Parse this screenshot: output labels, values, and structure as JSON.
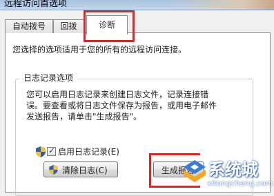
{
  "window": {
    "title": "远程访问首选项"
  },
  "tabs": [
    {
      "label": "自动拨号"
    },
    {
      "label": "回拨"
    },
    {
      "label": "诊断"
    }
  ],
  "description": "您选择的选项适用于您的所有的远程访问连接。",
  "log_group": {
    "title": "日志记录选项",
    "text_lines": [
      "您可以启用日志记录来创建日志文件，记录连接错",
      "误。要查看或将日志文件保存为报告，或用电子邮件",
      "发送报告，请单击\"生成报告\"。"
    ],
    "enable_logging": {
      "label": "启用日志记录(E)",
      "checked": true
    },
    "clear_log_label": "清除日志(C)"
  },
  "report_button": {
    "label": "生成报告"
  },
  "watermark": {
    "name": "系统城",
    "domain": "xitongcheng.com"
  },
  "colors": {
    "highlight": "#d62828",
    "accent": "#1f4c8f"
  }
}
